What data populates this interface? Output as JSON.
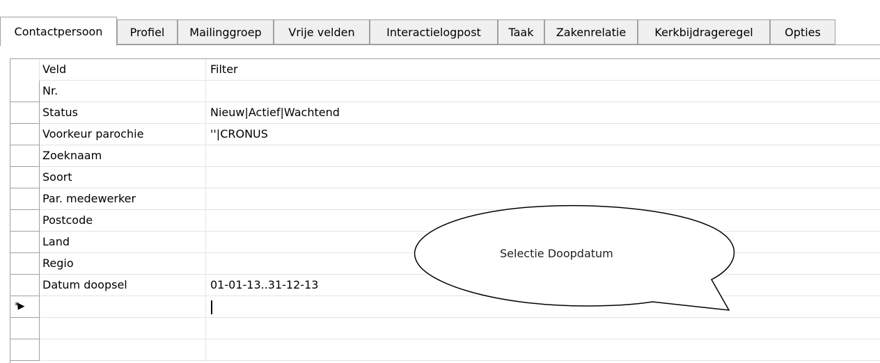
{
  "tabs": [
    {
      "label": "Contactpersoon",
      "active": true
    },
    {
      "label": "Profiel",
      "active": false
    },
    {
      "label": "Mailinggroep",
      "active": false
    },
    {
      "label": "Vrije velden",
      "active": false
    },
    {
      "label": "Interactielogpost",
      "active": false
    },
    {
      "label": "Taak",
      "active": false
    },
    {
      "label": "Zakenrelatie",
      "active": false
    },
    {
      "label": "Kerkbijdrageregel",
      "active": false
    },
    {
      "label": "Opties",
      "active": false
    }
  ],
  "grid": {
    "headers": {
      "veld": "Veld",
      "filter": "Filter"
    },
    "rows": [
      {
        "veld": "Nr.",
        "filter": ""
      },
      {
        "veld": "Status",
        "filter": "Nieuw|Actief|Wachtend"
      },
      {
        "veld": "Voorkeur parochie",
        "filter": "''|CRONUS"
      },
      {
        "veld": "Zoeknaam",
        "filter": ""
      },
      {
        "veld": "Soort",
        "filter": ""
      },
      {
        "veld": "Par. medewerker",
        "filter": ""
      },
      {
        "veld": "Postcode",
        "filter": ""
      },
      {
        "veld": "Land",
        "filter": ""
      },
      {
        "veld": "Regio",
        "filter": ""
      },
      {
        "veld": "Datum doopsel",
        "filter": "01-01-13..31-12-13"
      }
    ],
    "new_row_marker": "*▶"
  },
  "callout": {
    "text": "Selectie Doopdatum"
  },
  "colors": {
    "border": "#a0a0a0",
    "gridline": "#e3e3e3",
    "tab_inactive_bg": "#f0f0f0"
  }
}
